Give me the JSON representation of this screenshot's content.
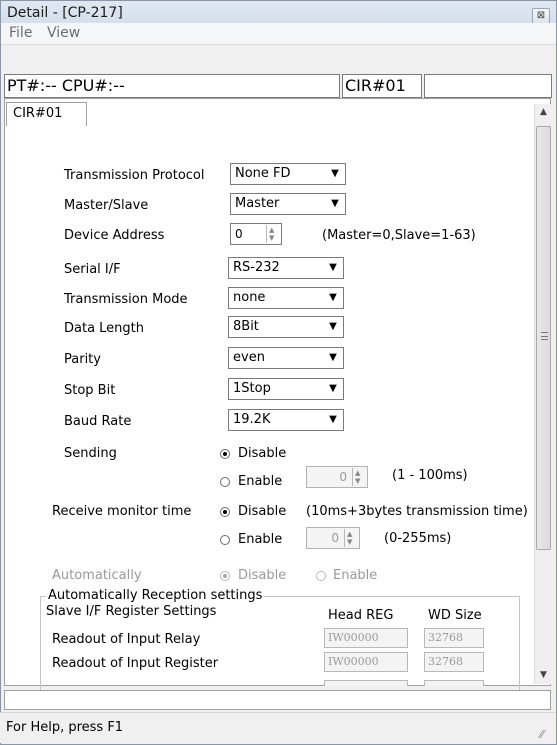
{
  "window": {
    "title": "Detail - [CP-217]",
    "close_glyph": "⊠"
  },
  "menu": [
    "File",
    "View"
  ],
  "header_fields": {
    "pt_cpu": "PT#:-- CPU#:--",
    "cir": "CIR#01",
    "extra": ""
  },
  "tab": {
    "label": "CIR#01"
  },
  "settings": [
    {
      "label": "Transmission Protocol",
      "value": "None FD"
    },
    {
      "label": "Master/Slave",
      "value": "Master"
    },
    {
      "label": "Device Address",
      "value": "0",
      "hint": "(Master=0,Slave=1-63)"
    },
    {
      "label": "Serial I/F",
      "value": "RS-232"
    },
    {
      "label": "Transmission Mode",
      "value": "none"
    },
    {
      "label": "Data Length",
      "value": "8Bit"
    },
    {
      "label": "Parity",
      "value": "even"
    },
    {
      "label": "Stop Bit",
      "value": "1Stop"
    },
    {
      "label": "Baud Rate",
      "value": "19.2K"
    }
  ],
  "sending": {
    "label": "Sending",
    "disable": "Disable",
    "enable": "Enable",
    "selected": "Disable",
    "spin_value": "0",
    "range": "(1 - 100ms)"
  },
  "receive_monitor": {
    "label": "Receive monitor time",
    "disable": "Disable",
    "enable": "Enable",
    "selected": "Disable",
    "disable_note": "(10ms+3bytes transmission time)",
    "spin_value": "0",
    "range": "(0-255ms)"
  },
  "automatically": {
    "label": "Automatically",
    "disable": "Disable",
    "enable": "Enable",
    "selected": "Disable"
  },
  "reception_group": {
    "title": "Automatically Reception settings",
    "subtitle": "Slave I/F Register Settings",
    "col_head_reg": "Head REG",
    "col_wd_size": "WD Size",
    "rows": [
      {
        "label": "Readout of Input Relay",
        "head_reg": "IW00000",
        "wd_size": "32768"
      },
      {
        "label": "Readout of Input Register",
        "head_reg": "IW00000",
        "wd_size": "32768"
      }
    ]
  },
  "status_bar": {
    "text": "For Help, press F1"
  },
  "icons": {
    "dropdown": "triangle-down",
    "spin": "up-down-arrows",
    "scroll": "scroll-arrows",
    "close": "close-icon"
  }
}
